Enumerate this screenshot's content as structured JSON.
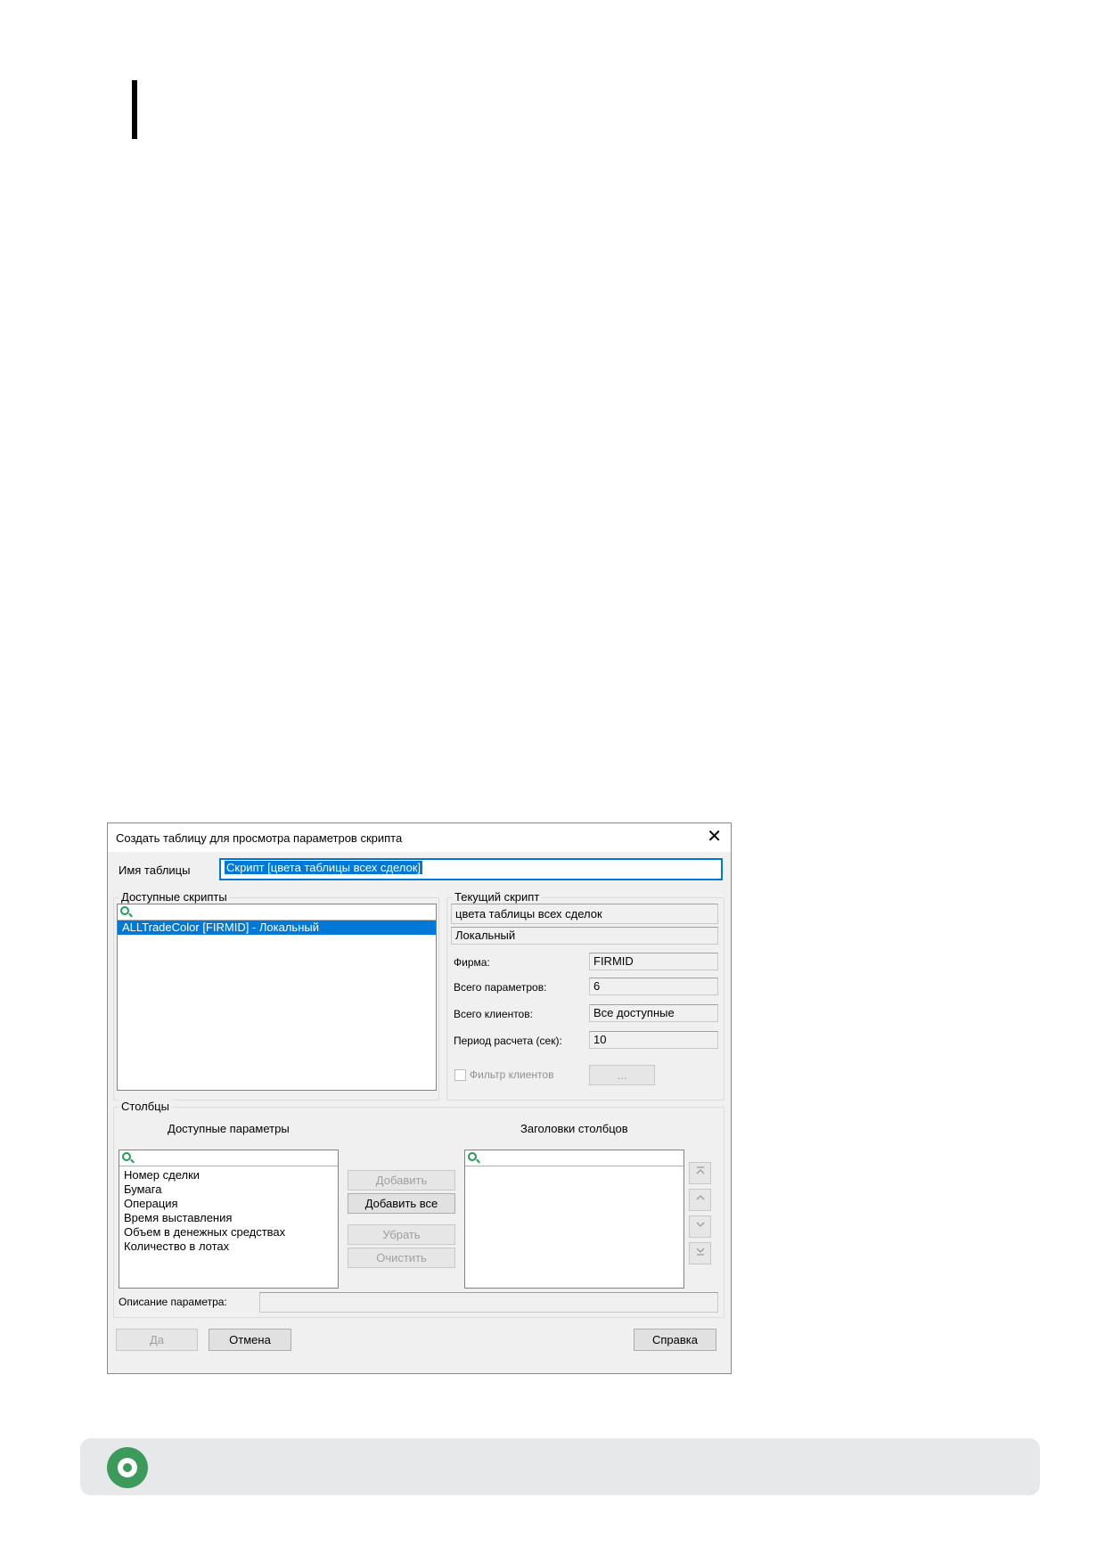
{
  "dialog": {
    "title": "Создать таблицу для просмотра параметров скрипта",
    "close_glyph": "✕",
    "table_name_label": "Имя таблицы",
    "table_name_value": "Скрипт [цвета таблицы всех сделок]",
    "available_scripts": {
      "group_title": "Доступные скрипты",
      "items": [
        "ALLTradeColor [FIRMID] - Локальный"
      ]
    },
    "current_script": {
      "group_title": "Текущий скрипт",
      "name": "цвета таблицы всех сделок",
      "type": "Локальный",
      "firm_label": "Фирма:",
      "firm_value": "FIRMID",
      "params_label": "Всего параметров:",
      "params_value": "6",
      "clients_label": "Всего клиентов:",
      "clients_value": "Все доступные",
      "period_label": "Период расчета (сек):",
      "period_value": "10",
      "client_filter_label": "Фильтр клиентов",
      "ellipsis_button": "..."
    },
    "columns": {
      "group_title": "Столбцы",
      "available_params_title": "Доступные параметры",
      "headers_title": "Заголовки столбцов",
      "available_params": [
        "Номер сделки",
        "Бумага",
        "Операция",
        "Время выставления",
        "Объем в денежных средствах",
        "Количество в лотах"
      ],
      "add_button": "Добавить",
      "add_all_button": "Добавить все",
      "remove_button": "Убрать",
      "clear_button": "Очистить",
      "move_top_icon": "move-top-icon",
      "move_up_icon": "move-up-icon",
      "move_down_icon": "move-down-icon",
      "move_bottom_icon": "move-bottom-icon"
    },
    "param_description_label": "Описание параметра:",
    "buttons": {
      "ok": "Да",
      "cancel": "Отмена",
      "help": "Справка"
    }
  },
  "colors": {
    "accent": "#0078d7",
    "logo_green": "#3c9a5b",
    "search_icon_green": "#1f9d55"
  }
}
